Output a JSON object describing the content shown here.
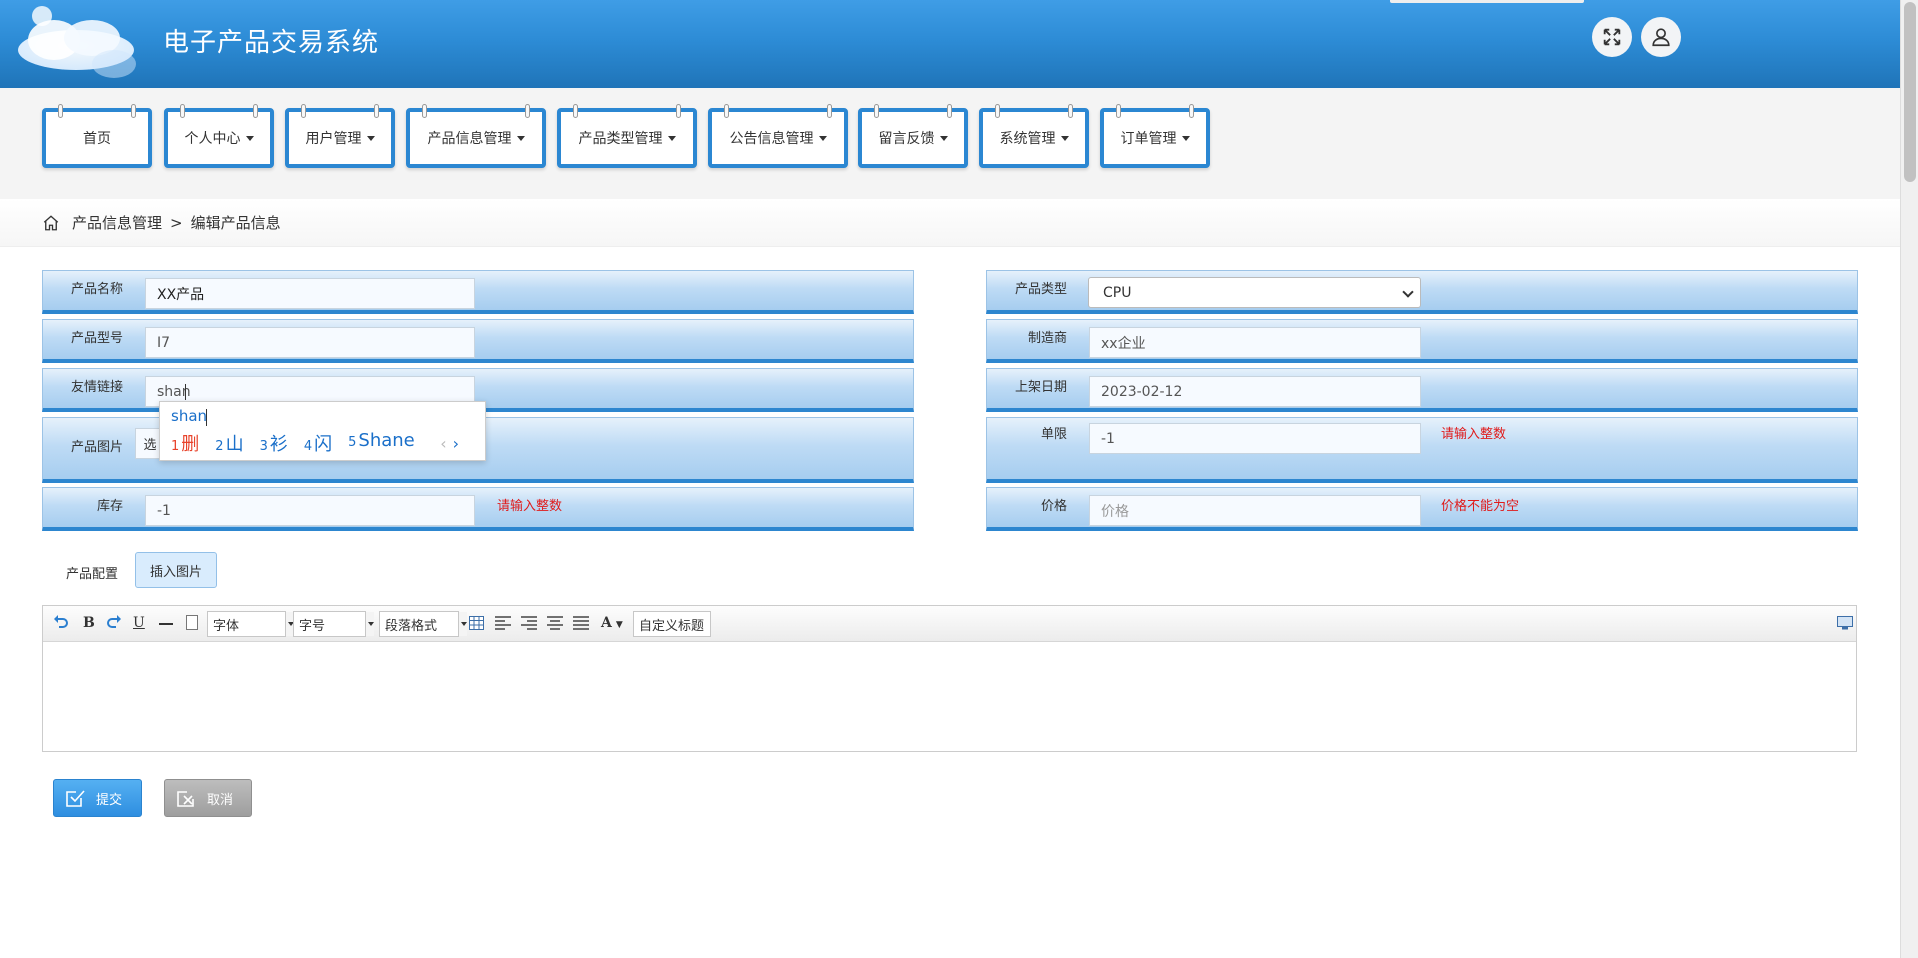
{
  "header": {
    "title": "电子产品交易系统",
    "fullscreen_icon": "fullscreen-icon",
    "user_icon": "user-icon"
  },
  "nav": {
    "items": [
      {
        "label": "首页",
        "dropdown": false
      },
      {
        "label": "个人中心",
        "dropdown": true
      },
      {
        "label": "用户管理",
        "dropdown": true
      },
      {
        "label": "产品信息管理",
        "dropdown": true
      },
      {
        "label": "产品类型管理",
        "dropdown": true
      },
      {
        "label": "公告信息管理",
        "dropdown": true
      },
      {
        "label": "留言反馈",
        "dropdown": true
      },
      {
        "label": "系统管理",
        "dropdown": true
      },
      {
        "label": "订单管理",
        "dropdown": true
      }
    ]
  },
  "breadcrumb": {
    "icon": "home-icon",
    "parent": "产品信息管理",
    "separator": ">",
    "current": "编辑产品信息"
  },
  "form": {
    "name": {
      "label": "产品名称",
      "value": "XX产品"
    },
    "model": {
      "label": "产品型号",
      "value": "I7"
    },
    "link": {
      "label": "友情链接",
      "value": "shan"
    },
    "image": {
      "label": "产品图片",
      "button_partial": "选"
    },
    "stock": {
      "label": "库存",
      "value": "-1",
      "error": "请输入整数"
    },
    "type": {
      "label": "产品类型",
      "value": "CPU"
    },
    "maker": {
      "label": "制造商",
      "value": "xx企业"
    },
    "date": {
      "label": "上架日期",
      "value": "2023-02-12"
    },
    "limit": {
      "label": "单限",
      "value": "-1",
      "error": "请输入整数"
    },
    "price": {
      "label": "价格",
      "placeholder": "价格",
      "error": "价格不能为空"
    }
  },
  "ime": {
    "composition": "shan",
    "candidates": [
      {
        "num": "1",
        "text": "删"
      },
      {
        "num": "2",
        "text": "山"
      },
      {
        "num": "3",
        "text": "衫"
      },
      {
        "num": "4",
        "text": "闪"
      },
      {
        "num": "5",
        "text": "Shane"
      }
    ],
    "prev": "‹",
    "next": "›"
  },
  "config": {
    "label": "产品配置",
    "insert_image": "插入图片",
    "toolbar": {
      "bold": "B",
      "underline": "U",
      "font": "字体",
      "size": "字号",
      "paragraph": "段落格式",
      "color": "A",
      "custom_title": "自定义标题"
    }
  },
  "actions": {
    "submit": "提交",
    "cancel": "取消"
  },
  "colors": {
    "header": "#2d8cd6",
    "nav_border": "#2b87d2",
    "error": "#e01b1b",
    "ime_accent": "#1a6fc9"
  }
}
